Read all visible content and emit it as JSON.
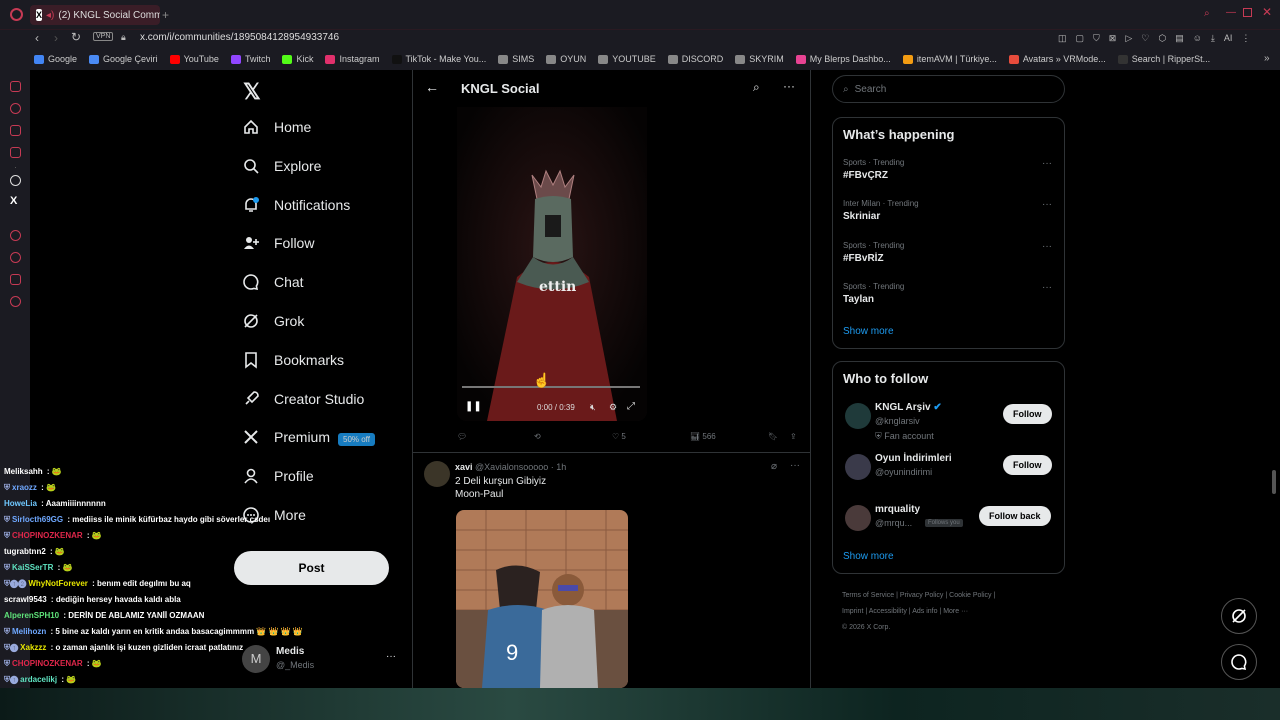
{
  "browser": {
    "tab_title": "(2) KNGL Social Comm",
    "url": "x.com/i/communities/1895084128954933746",
    "vpn_badge": "VPN",
    "bookmarks": [
      {
        "label": "Google",
        "color": "#4285f4"
      },
      {
        "label": "Google Çeviri",
        "color": "#4a8af4"
      },
      {
        "label": "YouTube",
        "color": "#ff0000"
      },
      {
        "label": "Twitch",
        "color": "#9146ff"
      },
      {
        "label": "Kick",
        "color": "#53fc18"
      },
      {
        "label": "Instagram",
        "color": "#e1306c"
      },
      {
        "label": "TikTok - Make You...",
        "color": "#111111"
      },
      {
        "label": "SIMS",
        "color": "#888888"
      },
      {
        "label": "OYUN",
        "color": "#888888"
      },
      {
        "label": "YOUTUBE",
        "color": "#888888"
      },
      {
        "label": "DISCORD",
        "color": "#888888"
      },
      {
        "label": "SKYRIM",
        "color": "#888888"
      },
      {
        "label": "My Blerps Dashbo...",
        "color": "#e84393"
      },
      {
        "label": "itemAVM | Türkiye...",
        "color": "#f39c12"
      },
      {
        "label": "Avatars » VRMode...",
        "color": "#e74c3c"
      },
      {
        "label": "Search | RipperSt...",
        "color": "#333333"
      }
    ]
  },
  "sidebar": {
    "items": [
      {
        "label": "Home",
        "icon": "home-icon"
      },
      {
        "label": "Explore",
        "icon": "search-icon"
      },
      {
        "label": "Notifications",
        "icon": "bell-icon"
      },
      {
        "label": "Follow",
        "icon": "person-plus-icon"
      },
      {
        "label": "Chat",
        "icon": "chat-bubble-icon"
      },
      {
        "label": "Grok",
        "icon": "grok-icon"
      },
      {
        "label": "Bookmarks",
        "icon": "bookmark-icon"
      },
      {
        "label": "Creator Studio",
        "icon": "rocket-icon"
      },
      {
        "label": "Premium",
        "icon": "x-logo-icon"
      },
      {
        "label": "Profile",
        "icon": "person-icon"
      },
      {
        "label": "More",
        "icon": "more-circle-icon"
      }
    ],
    "premium_badge": "50% off",
    "post_label": "Post",
    "account_name": "Medis",
    "account_handle": "@_Medis",
    "account_initial": "M"
  },
  "main": {
    "title": "KNGL Social",
    "video_caption": "ettin",
    "video_time": "0:00 / 0:39",
    "video_progress": 0,
    "tweet1_actions": {
      "likes": "5",
      "views": "566"
    },
    "tweet2": {
      "author": "xavi",
      "handle": "@Xavialonsooooo",
      "time": "· 1h",
      "text_line1": "2 Deli kurşun Gibiyiz",
      "text_line2": "Moon-Paul"
    }
  },
  "right": {
    "search_placeholder": "Search",
    "happening_title": "What’s happening",
    "trends": [
      {
        "context": "Sports · Trending",
        "name": "#FBvÇRZ"
      },
      {
        "context": "Inter Milan · Trending",
        "name": "Skriniar"
      },
      {
        "context": "Sports · Trending",
        "name": "#FBvRİZ"
      },
      {
        "context": "Sports · Trending",
        "name": "Taylan"
      }
    ],
    "show_more": "Show more",
    "who_title": "Who to follow",
    "who": [
      {
        "name": "KNGL Arşiv",
        "handle": "@knglarsiv",
        "extra": "Fan account",
        "button": "Follow"
      },
      {
        "name": "Oyun İndirimleri",
        "handle": "@oyunindirimi",
        "extra": "",
        "button": "Follow"
      },
      {
        "name": "mrquality",
        "handle": "@mrqu...",
        "extra": "Follows you",
        "button": "Follow back"
      }
    ],
    "who_show_more": "Show more",
    "footer": {
      "row1": [
        "Terms of Service",
        "Privacy Policy",
        "Cookie Policy"
      ],
      "row2": [
        "Imprint",
        "Accessibility",
        "Ads info",
        "More ···"
      ],
      "copyright": "© 2026 X Corp."
    }
  },
  "chat": [
    {
      "user": "Meliksahh",
      "color": "#ffffff",
      "msg": "🐸",
      "badge": ""
    },
    {
      "user": "xraozz",
      "color": "#6fa8ff",
      "msg": "🐸",
      "badge": "⛨"
    },
    {
      "user": "HoweLia",
      "color": "#6fc8ff",
      "msg": "Aaamiiiinnnnnn",
      "badge": ""
    },
    {
      "user": "Sirlocth69GG",
      "color": "#6fa8ff",
      "msg": "mediiss ile minik küfürbaz haydo gibi söverler çsdeı",
      "badge": "⛨"
    },
    {
      "user": "CHOPINOZKENAR",
      "color": "#e0274b",
      "msg": "🐸",
      "badge": "⛨"
    },
    {
      "user": "tugrabtnn2",
      "color": "#ffffff",
      "msg": "🐸",
      "badge": ""
    },
    {
      "user": "KaiSSerTR",
      "color": "#5fe3c1",
      "msg": "🐸",
      "badge": "⛨"
    },
    {
      "user": "WhyNotForever",
      "color": "#e6e600",
      "msg": "benım edit degılmı bu aq",
      "badge": "⛨❶❷"
    },
    {
      "user": "scrawl9543",
      "color": "#ffffff",
      "msg": "dediğin hersey havada kaldı abla",
      "badge": ""
    },
    {
      "user": "AlperenSPH10",
      "color": "#5fe37a",
      "msg": "DERİN DE ABLAMIZ YANİİ OZMAAN",
      "badge": ""
    },
    {
      "user": "Melihozn",
      "color": "#6fa8ff",
      "msg": "5 bine az kaldı yarın en kritik andaa basacagimmmm 👑 👑 👑 👑",
      "badge": "⛨"
    },
    {
      "user": "Xakzzz",
      "color": "#e6e600",
      "msg": "o zaman ajanlık işi kuzen gizliden icraat patlatınız",
      "badge": "⛨❶"
    },
    {
      "user": "CHOPINOZKENAR",
      "color": "#e0274b",
      "msg": "🐸",
      "badge": "⛨"
    },
    {
      "user": "ardacelikj",
      "color": "#5fe3c1",
      "msg": "🐸",
      "badge": "⛨❶"
    }
  ]
}
